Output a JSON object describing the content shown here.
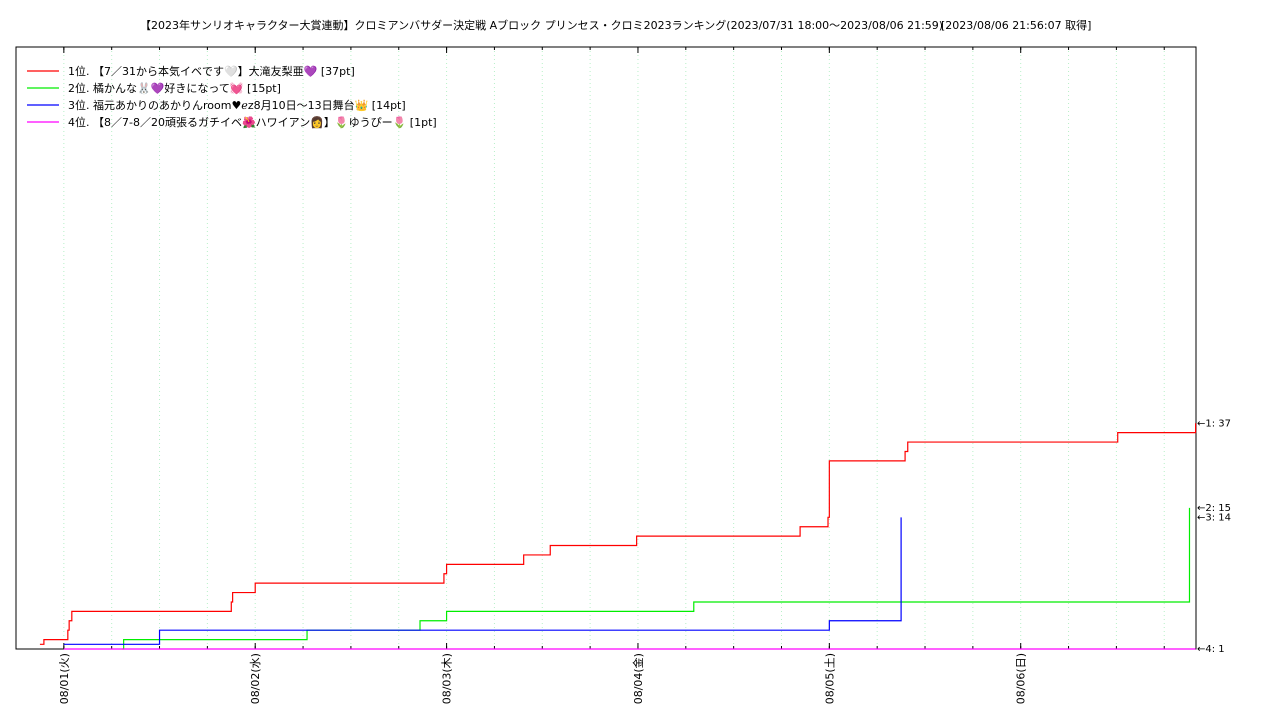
{
  "page": {
    "title": "【2023年サンリオキャラクター大賞連動】クロミアンバサダー決定戦 Aブロック プリンセス・クロミ2023ランキング(2023/07/31 18:00〜2023/08/06 21:59)",
    "retrieved": "[2023/08/06 21:56:07 取得]"
  },
  "chart_data": {
    "type": "line",
    "title": "【2023年サンリオキャラクター大賞連動】クロミアンバサダー決定戦 Aブロック プリンセス・クロミ2023ランキング(2023/07/31 18:00〜2023/08/06 21:59)",
    "xlabel": "",
    "ylabel": "",
    "x_unit": "date (2023-08)",
    "xlim": [
      "2023-07-31 18:00",
      "2023-08-06 21:59"
    ],
    "ylim": [
      0,
      64
    ],
    "x_tick_labels": [
      "08/01(火)",
      "08/02(水)",
      "08/03(木)",
      "08/04(金)",
      "08/05(土)",
      "08/06(日)"
    ],
    "x_tick_dates": [
      "2023-08-01 00:00",
      "2023-08-02 00:00",
      "2023-08-03 00:00",
      "2023-08-04 00:00",
      "2023-08-05 00:00",
      "2023-08-06 00:00"
    ],
    "grid": "vertical dotted, every 6 hours",
    "legend_position": "top-left",
    "step": true,
    "series": [
      {
        "name": "1位. 【7／31から本気イベです🤍】大滝友梨亜💜 [37pt]",
        "color": "#ff0000",
        "end_label": "←1: 37",
        "points": [
          [
            "2023-07-31 21:00",
            0.5
          ],
          [
            "2023-07-31 21:30",
            1
          ],
          [
            "2023-08-01 00:30",
            2
          ],
          [
            "2023-08-01 00:40",
            3
          ],
          [
            "2023-08-01 01:00",
            4
          ],
          [
            "2023-08-01 21:00",
            5
          ],
          [
            "2023-08-01 21:10",
            6
          ],
          [
            "2023-08-02 00:00",
            7
          ],
          [
            "2023-08-02 23:40",
            8
          ],
          [
            "2023-08-03 00:00",
            9
          ],
          [
            "2023-08-03 09:40",
            10
          ],
          [
            "2023-08-03 13:00",
            11
          ],
          [
            "2023-08-03 23:50",
            12
          ],
          [
            "2023-08-04 20:20",
            13
          ],
          [
            "2023-08-04 23:50",
            14
          ],
          [
            "2023-08-05 00:00",
            20
          ],
          [
            "2023-08-05 09:30",
            21
          ],
          [
            "2023-08-05 09:50",
            22
          ],
          [
            "2023-08-06 12:10",
            23
          ],
          [
            "2023-08-06 21:56",
            24
          ]
        ]
      },
      {
        "name": "2位. 橘かんな🐰💜好きになって💓 [15pt]",
        "color": "#00ee00",
        "end_label": "←2: 15",
        "points": [
          [
            "2023-08-01 07:20",
            0
          ],
          [
            "2023-08-01 07:30",
            1
          ],
          [
            "2023-08-02 06:30",
            2
          ],
          [
            "2023-08-02 20:40",
            3
          ],
          [
            "2023-08-03 00:00",
            4
          ],
          [
            "2023-08-04 07:00",
            5
          ],
          [
            "2023-08-06 21:10",
            15
          ]
        ]
      },
      {
        "name": "3位. 福元あかりのあかりんroom♥ℯz8月10日〜13日舞台👑 [14pt]",
        "color": "#0000ff",
        "end_label": "←3: 14",
        "points": [
          [
            "2023-08-01 00:00",
            0.5
          ],
          [
            "2023-08-01 12:00",
            2
          ],
          [
            "2023-08-05 00:00",
            3
          ],
          [
            "2023-08-05 09:00",
            14
          ]
        ]
      },
      {
        "name": "4位. 【8／7-8／20頑張るガチイベ🌺ハワイアン👩】🌷ゆうぴー🌷 [1pt]",
        "color": "#ff00ff",
        "end_label": "←4: 1",
        "points": [
          [
            "2023-08-01 00:00",
            0
          ],
          [
            "2023-08-06 21:56",
            0
          ]
        ]
      }
    ]
  }
}
